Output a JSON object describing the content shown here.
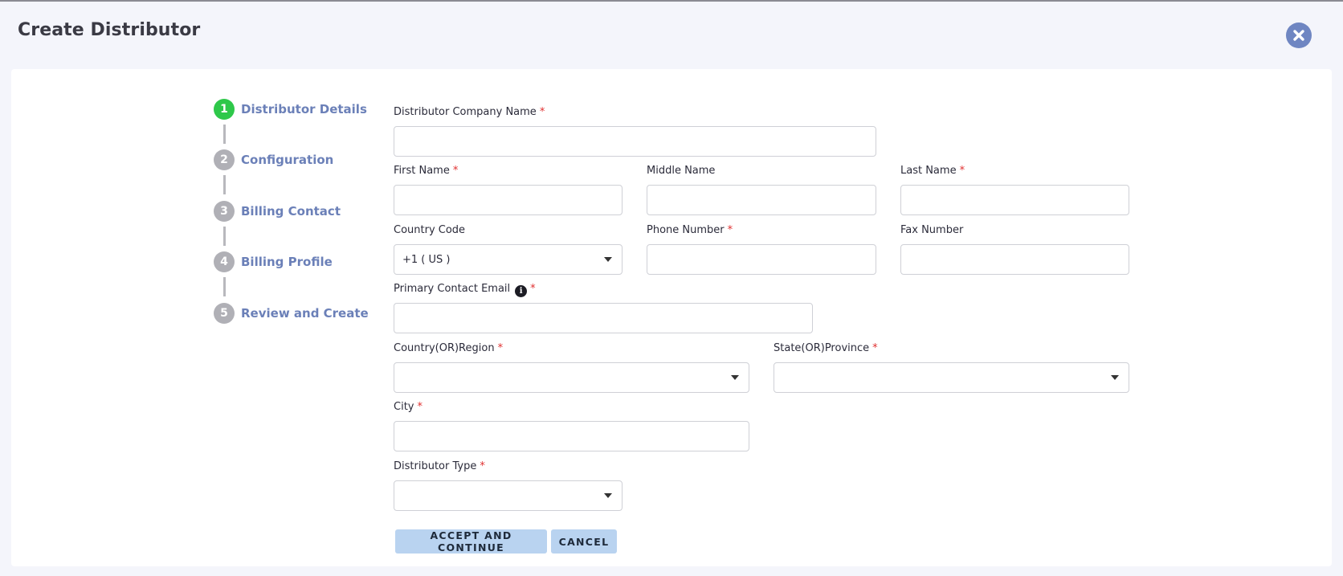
{
  "header": {
    "title": "Create Distributor",
    "close_icon": "close-circle-icon"
  },
  "steps": [
    {
      "number": "1",
      "label": "Distributor Details",
      "active": true
    },
    {
      "number": "2",
      "label": "Configuration",
      "active": false
    },
    {
      "number": "3",
      "label": "Billing Contact",
      "active": false
    },
    {
      "number": "4",
      "label": "Billing Profile",
      "active": false
    },
    {
      "number": "5",
      "label": "Review and Create",
      "active": false
    }
  ],
  "form": {
    "required_mark": "*",
    "company_name": {
      "label": "Distributor Company Name",
      "value": ""
    },
    "first_name": {
      "label": "First Name",
      "value": ""
    },
    "middle_name": {
      "label": "Middle Name",
      "value": ""
    },
    "last_name": {
      "label": "Last Name",
      "value": ""
    },
    "country_code": {
      "label": "Country Code",
      "value": "+1 ( US )"
    },
    "phone_number": {
      "label": "Phone Number",
      "value": ""
    },
    "fax_number": {
      "label": "Fax Number",
      "value": ""
    },
    "primary_email": {
      "label": "Primary Contact Email",
      "value": "",
      "info_glyph": "i"
    },
    "country_region": {
      "label": "Country(OR)Region",
      "value": ""
    },
    "state_province": {
      "label": "State(OR)Province",
      "value": ""
    },
    "city": {
      "label": "City",
      "value": ""
    },
    "distributor_type": {
      "label": "Distributor Type",
      "value": ""
    }
  },
  "actions": {
    "accept_label": "ACCEPT AND CONTINUE",
    "cancel_label": "CANCEL"
  },
  "colors": {
    "active_step": "#2ec84a",
    "inactive_step": "#b0b0b6",
    "step_label": "#6b80b8",
    "button_bg": "#b9d3f0",
    "required": "#e03030"
  }
}
